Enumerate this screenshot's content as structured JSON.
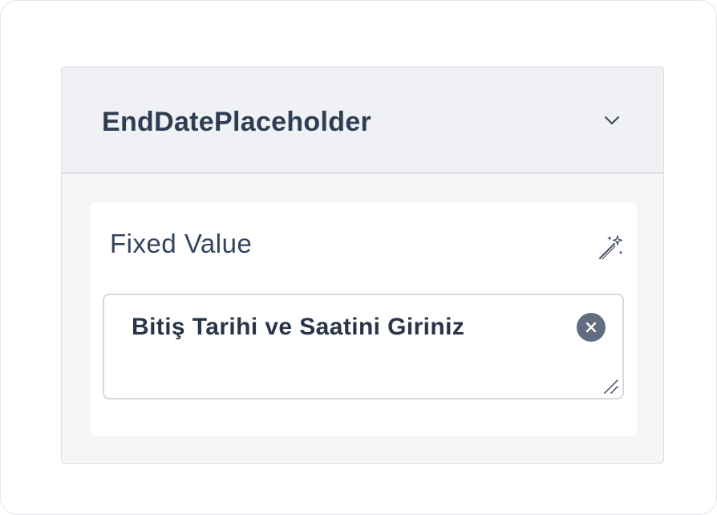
{
  "panel": {
    "title": "EndDatePlaceholder",
    "expanded": true,
    "toggle_icon": "chevron-down-icon"
  },
  "field": {
    "label": "Fixed Value",
    "action_icon": "magic-wand-icon",
    "value": "Bitiş Tarihi ve Saatini Giriniz",
    "clear_icon": "clear-circle-icon",
    "resize_icon": "resize-handle-icon"
  },
  "colors": {
    "title_text": "#2f3d53",
    "header_bg": "#eff1f4",
    "panel_bg": "#f4f5f7",
    "clear_button_bg": "#616d80",
    "border": "#dcdee3"
  }
}
